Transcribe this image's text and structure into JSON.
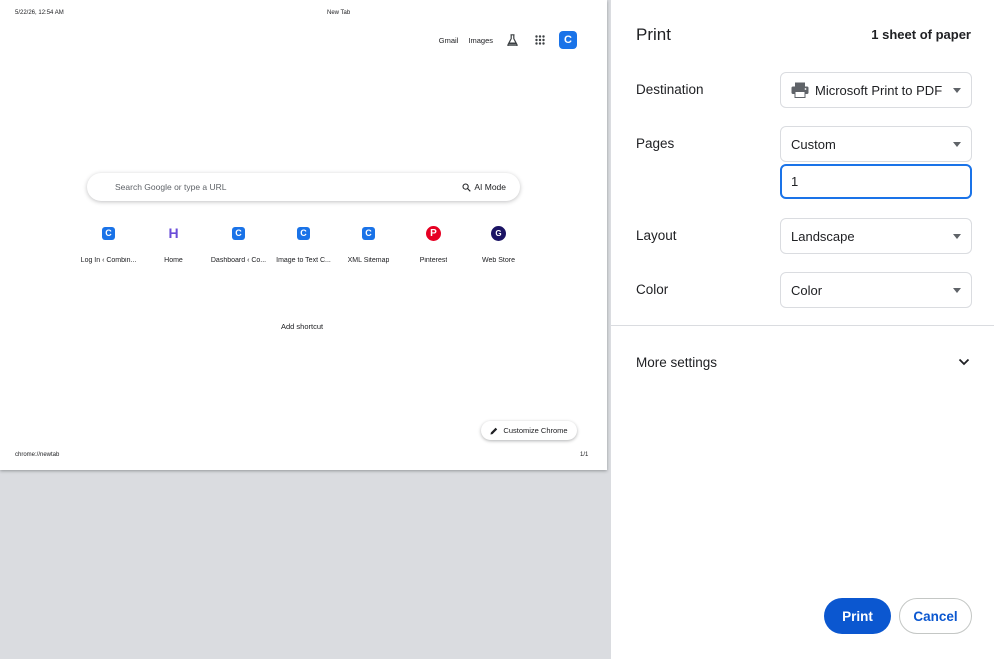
{
  "preview": {
    "header_date": "5/22/26, 12:54 AM",
    "header_title": "New Tab",
    "footer_url": "chrome://newtab",
    "footer_page": "1/1",
    "top_links": {
      "gmail": "Gmail",
      "images": "Images",
      "avatar_letter": "C"
    },
    "search": {
      "placeholder": "Search Google or type a URL",
      "ai_mode": "AI Mode"
    },
    "shortcuts": [
      {
        "label": "Log In ‹ Combin...",
        "icon": "c-icon",
        "glyph": "C"
      },
      {
        "label": "Home",
        "icon": "h-logo-icon",
        "glyph": "H"
      },
      {
        "label": "Dashboard ‹ Co...",
        "icon": "c-icon",
        "glyph": "C"
      },
      {
        "label": "Image to Text C...",
        "icon": "c-icon",
        "glyph": "C"
      },
      {
        "label": "XML Sitemap",
        "icon": "c-icon",
        "glyph": "C"
      },
      {
        "label": "Pinterest",
        "icon": "pinterest-icon",
        "glyph": "P"
      },
      {
        "label": "Web Store",
        "icon": "g-icon",
        "glyph": "G"
      }
    ],
    "add_shortcut": "Add shortcut",
    "customize_label": "Customize Chrome"
  },
  "panel": {
    "title": "Print",
    "sheet_count": "1 sheet of paper",
    "destination": {
      "label": "Destination",
      "value": "Microsoft Print to PDF"
    },
    "pages": {
      "label": "Pages",
      "value": "Custom",
      "input_value": "1"
    },
    "layout": {
      "label": "Layout",
      "value": "Landscape"
    },
    "color": {
      "label": "Color",
      "value": "Color"
    },
    "more_settings": "More settings",
    "print_label": "Print",
    "cancel_label": "Cancel"
  },
  "colors": {
    "accent": "#0b57d0",
    "focus": "#1a73e8",
    "preview_bg": "#dadce0"
  }
}
